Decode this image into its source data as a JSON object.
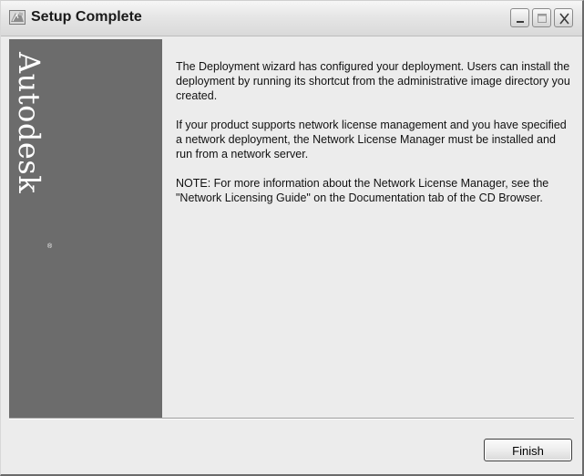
{
  "window": {
    "title": "Setup Complete",
    "icon": "autodesk-app-icon",
    "controls": [
      "minimize-icon",
      "maximize-icon",
      "close-icon"
    ]
  },
  "sidebar": {
    "brand": "Autodesk",
    "brand_mark": "®",
    "color": "#6c6c6c"
  },
  "content": {
    "paragraphs": [
      "The Deployment wizard has configured your deployment.  Users can install the deployment by running its shortcut from the administrative image directory you created.",
      "If your product supports network license management and you have specified a network deployment, the Network License Manager must be installed and run from a network server.",
      "NOTE: For more information about the Network License Manager, see the \"Network Licensing Guide\" on the Documentation tab of the CD Browser."
    ]
  },
  "footer": {
    "finish_label": "Finish"
  }
}
